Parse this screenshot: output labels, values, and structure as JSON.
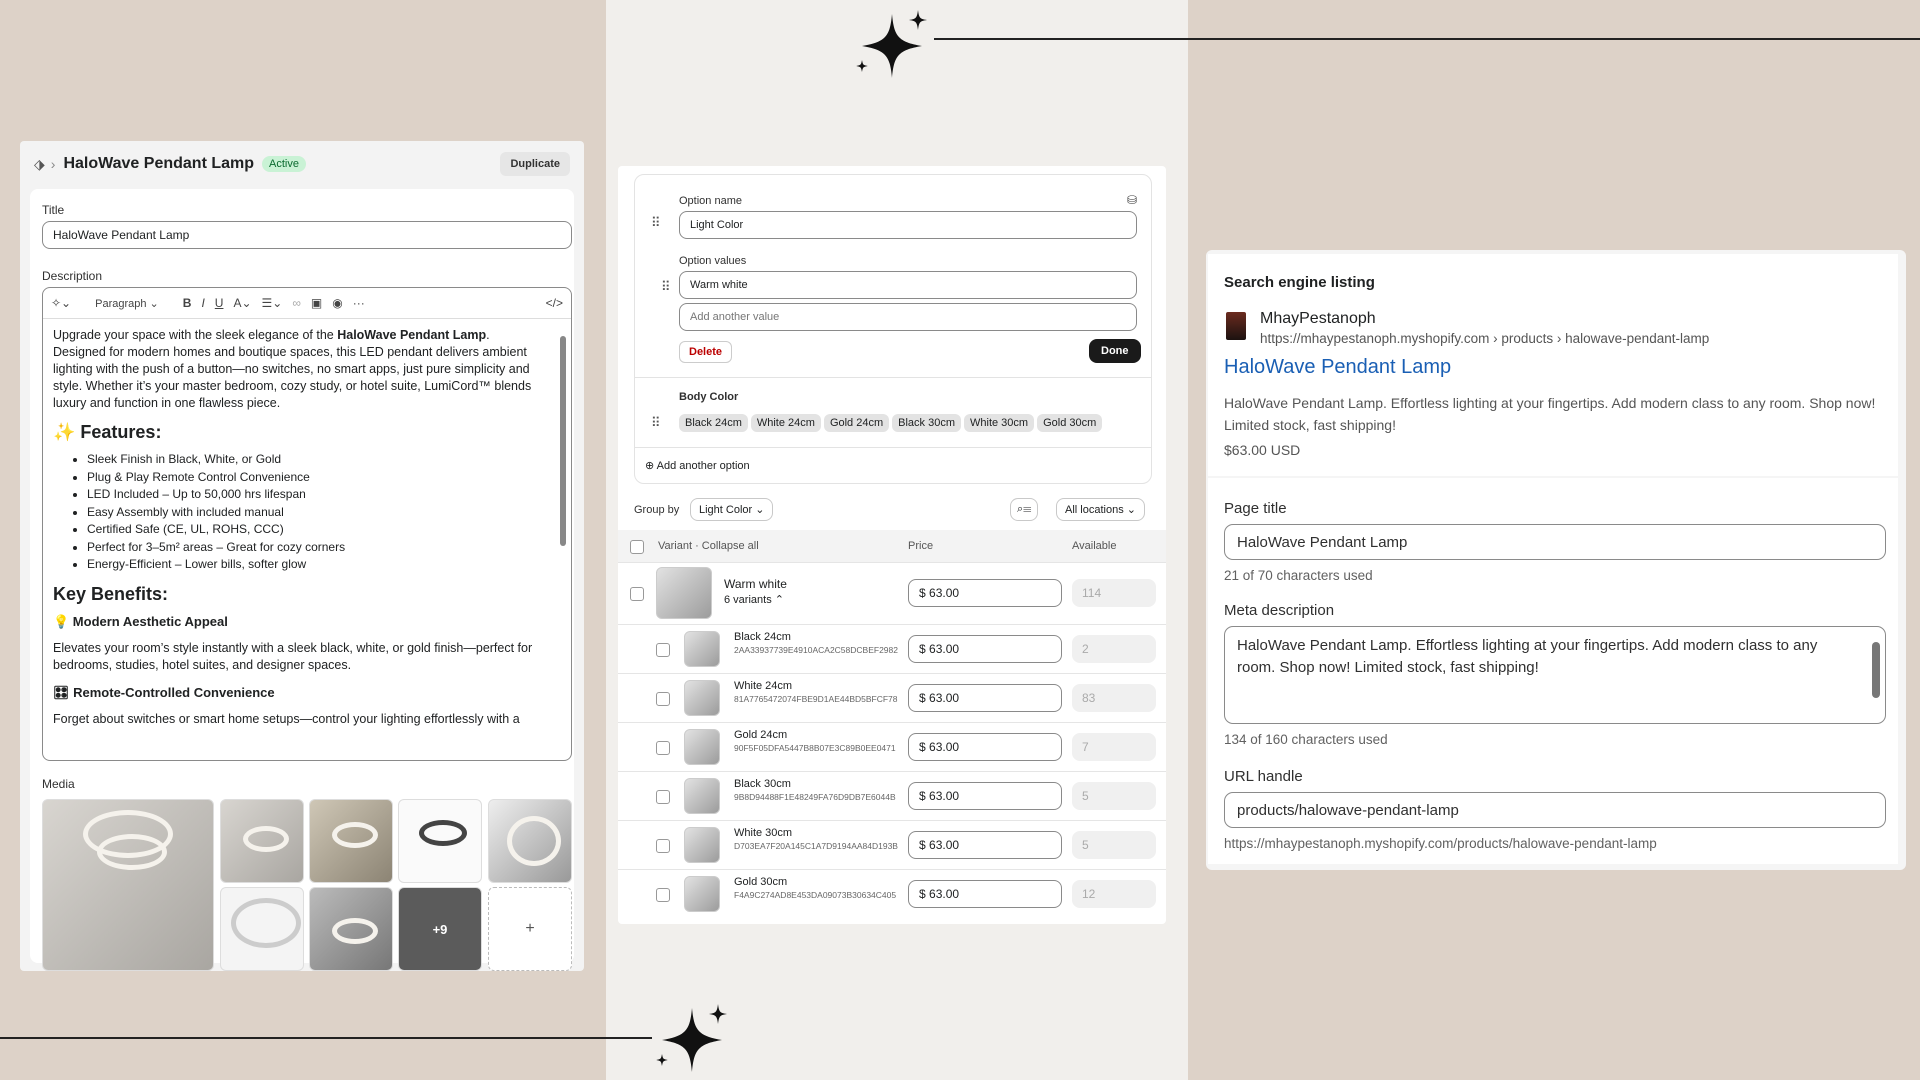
{
  "left": {
    "breadcrumb_title": "HaloWave Pendant Lamp",
    "status_badge": "Active",
    "duplicate_label": "Duplicate",
    "title_label": "Title",
    "title_value": "HaloWave Pendant Lamp",
    "description_label": "Description",
    "toolbar_paragraph": "Paragraph",
    "intro_pre": "Upgrade your space with the sleek elegance of the ",
    "intro_bold": "HaloWave Pendant Lamp",
    "intro_post": ". Designed for modern homes and boutique spaces, this LED pendant delivers ambient lighting with the push of a button—no switches, no smart apps, just pure simplicity and style. Whether it’s your master bedroom, cozy study, or hotel suite, LumiCord™ blends luxury and function in one flawless piece.",
    "features_heading": "✨ Features:",
    "features": [
      "Sleek Finish in Black, White, or Gold",
      "Plug & Play Remote Control Convenience",
      "LED Included – Up to 50,000 hrs lifespan",
      "Easy Assembly with included manual",
      "Certified Safe (CE, UL, ROHS, CCC)",
      "Perfect for 3–5m² areas – Great for cozy corners",
      "Energy-Efficient – Lower bills, softer glow"
    ],
    "benefits_heading": "Key Benefits:",
    "benefit1_heading": "💡 Modern Aesthetic Appeal",
    "benefit1_text": "Elevates your room’s style instantly with a sleek black, white, or gold finish—perfect for bedrooms, studies, hotel suites, and designer spaces.",
    "benefit2_heading": "🎛 Remote-Controlled Convenience",
    "benefit2_text": "Forget about switches or smart home setups—control your lighting effortlessly with a",
    "media_label": "Media",
    "media_more": "+9",
    "media_add": "+"
  },
  "middle": {
    "option_name_label": "Option name",
    "option_name_value": "Light Color",
    "option_values_label": "Option values",
    "option_value_1": "Warm white",
    "add_value_placeholder": "Add another value",
    "delete_label": "Delete",
    "done_label": "Done",
    "body_color_label": "Body Color",
    "body_color_chips": [
      "Black 24cm",
      "White 24cm",
      "Gold 24cm",
      "Black 30cm",
      "White 30cm",
      "Gold 30cm"
    ],
    "add_option_label": "Add another option",
    "group_by_label": "Group by",
    "group_by_value": "Light Color",
    "locations_value": "All locations",
    "col_variant": "Variant · Collapse all",
    "col_price": "Price",
    "col_available": "Available",
    "group_row": {
      "name": "Warm white",
      "sub": "6 variants",
      "currency": "$",
      "price": "63.00",
      "available": "114"
    },
    "variants": [
      {
        "name": "Black 24cm",
        "sku": "2AA33937739E4910ACA2C58DCBEF2982",
        "currency": "$",
        "price": "63.00",
        "available": "2"
      },
      {
        "name": "White 24cm",
        "sku": "81A7765472074FBE9D1AE44BD5BFCF78",
        "currency": "$",
        "price": "63.00",
        "available": "83"
      },
      {
        "name": "Gold 24cm",
        "sku": "90F5F05DFA5447B8B07E3C89B0EE0471",
        "currency": "$",
        "price": "63.00",
        "available": "7"
      },
      {
        "name": "Black 30cm",
        "sku": "9B8D94488F1E48249FA76D9DB7E6044B",
        "currency": "$",
        "price": "63.00",
        "available": "5"
      },
      {
        "name": "White 30cm",
        "sku": "D703EA7F20A145C1A7D9194AA84D193B",
        "currency": "$",
        "price": "63.00",
        "available": "5"
      },
      {
        "name": "Gold 30cm",
        "sku": "F4A9C274AD8E453DA09073B30634C405",
        "currency": "$",
        "price": "63.00",
        "available": "12"
      }
    ]
  },
  "right": {
    "seo_heading": "Search engine listing",
    "store_name": "MhayPestanoph",
    "store_url": "https://mhaypestanoph.myshopify.com › products › halowave-pendant-lamp",
    "seo_title": "HaloWave Pendant Lamp",
    "seo_description": "HaloWave Pendant Lamp. Effortless lighting at your fingertips. Add modern class to any room. Shop now! Limited stock, fast shipping!",
    "seo_price": "$63.00 USD",
    "page_title_label": "Page title",
    "page_title_value": "HaloWave Pendant Lamp",
    "page_title_count": "21 of 70 characters used",
    "meta_label": "Meta description",
    "meta_value": "HaloWave Pendant Lamp. Effortless lighting at your fingertips. Add modern class to any room. Shop now! Limited stock, fast shipping!",
    "meta_count": "134 of 160 characters used",
    "url_label": "URL handle",
    "url_value": "products/halowave-pendant-lamp",
    "full_url": "https://mhaypestanoph.myshopify.com/products/halowave-pendant-lamp"
  },
  "colors": {
    "link_blue": "#1a5fb4",
    "badge_green": "#c9f2d5",
    "background": "#ddd2c8"
  }
}
